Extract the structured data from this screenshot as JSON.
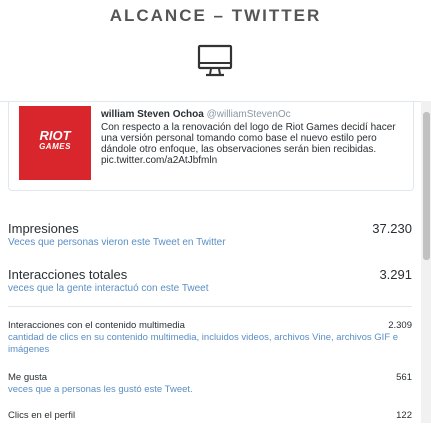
{
  "header": {
    "title": "ALCANCE – TWITTER"
  },
  "tweet": {
    "author_name": "william Steven Ochoa",
    "author_handle": "@williamStevenOc",
    "text": "Con respecto a la renovación del logo de Riot Games decidí hacer una versión personal tomando como base el nuevo estilo pero dándole otro enfoque, las observaciones serán bien recibidas. pic.twitter.com/a2AtJbfmln",
    "image": {
      "line1": "RIOT",
      "line2": "GAMES",
      "background": "#d9262d"
    }
  },
  "metrics": {
    "impresiones": {
      "label": "Impresiones",
      "value": "37.230",
      "desc": "Veces que personas vieron este Tweet en Twitter"
    },
    "interacciones": {
      "label": "Interacciones totales",
      "value": "3.291",
      "desc": "veces que la gente interactuó con este Tweet"
    },
    "multimedia": {
      "label": "Interacciones con el contenido multimedia",
      "value": "2.309",
      "desc": "cantidad de clics en su contenido multimedia, incluidos videos, archivos Vine, archivos GIF e imágenes"
    },
    "me_gusta": {
      "label": "Me gusta",
      "value": "561",
      "desc": "veces que a personas les gustó este Tweet."
    },
    "clics_perfil": {
      "label": "Clics en el perfil",
      "value": "122"
    }
  },
  "colors": {
    "link": "#5a8ec4",
    "title": "#555555"
  },
  "icons": {
    "header": "monitor-icon"
  }
}
